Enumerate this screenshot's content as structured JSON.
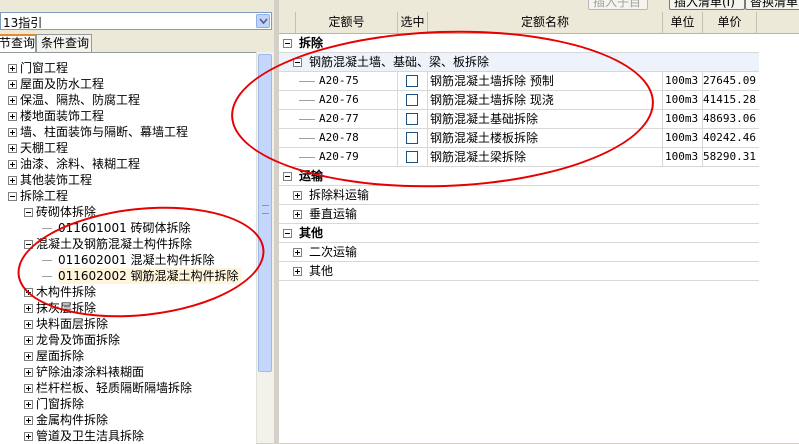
{
  "left": {
    "combo_value": "13指引",
    "tabs": [
      "章节查询",
      "条件查询"
    ],
    "tree": [
      {
        "label": "门窗工程",
        "level": 0,
        "state": "collapsed"
      },
      {
        "label": "屋面及防水工程",
        "level": 0,
        "state": "collapsed"
      },
      {
        "label": "保温、隔热、防腐工程",
        "level": 0,
        "state": "collapsed"
      },
      {
        "label": "楼地面装饰工程",
        "level": 0,
        "state": "collapsed"
      },
      {
        "label": "墙、柱面装饰与隔断、幕墙工程",
        "level": 0,
        "state": "collapsed"
      },
      {
        "label": "天棚工程",
        "level": 0,
        "state": "collapsed"
      },
      {
        "label": "油漆、涂料、裱糊工程",
        "level": 0,
        "state": "collapsed"
      },
      {
        "label": "其他装饰工程",
        "level": 0,
        "state": "collapsed"
      },
      {
        "label": "拆除工程",
        "level": 0,
        "state": "expanded"
      },
      {
        "label": "砖砌体拆除",
        "level": 1,
        "state": "expanded"
      },
      {
        "label": "011601001   砖砌体拆除",
        "level": 2,
        "state": "leaf"
      },
      {
        "label": "混凝土及钢筋混凝土构件拆除",
        "level": 1,
        "state": "expanded"
      },
      {
        "label": "011602001   混凝土构件拆除",
        "level": 2,
        "state": "leaf"
      },
      {
        "label": "011602002   钢筋混凝土构件拆除",
        "level": 2,
        "state": "leaf",
        "selected": true
      },
      {
        "label": "木构件拆除",
        "level": 1,
        "state": "collapsed"
      },
      {
        "label": "抹灰层拆除",
        "level": 1,
        "state": "collapsed"
      },
      {
        "label": "块料面层拆除",
        "level": 1,
        "state": "collapsed"
      },
      {
        "label": "龙骨及饰面拆除",
        "level": 1,
        "state": "collapsed"
      },
      {
        "label": "屋面拆除",
        "level": 1,
        "state": "collapsed"
      },
      {
        "label": "铲除油漆涂料裱糊面",
        "level": 1,
        "state": "collapsed"
      },
      {
        "label": "栏杆栏板、轻质隔断隔墙拆除",
        "level": 1,
        "state": "collapsed"
      },
      {
        "label": "门窗拆除",
        "level": 1,
        "state": "collapsed"
      },
      {
        "label": "金属构件拆除",
        "level": 1,
        "state": "collapsed"
      },
      {
        "label": "管道及卫生洁具拆除",
        "level": 1,
        "state": "collapsed"
      }
    ]
  },
  "toolbar": {
    "insert_sub_label": "插入子目",
    "insert_list_label": "插入清单(I)",
    "replace_list_label": "替换清单"
  },
  "grid": {
    "columns": [
      "定额号",
      "选中",
      "定额名称",
      "单位",
      "单价"
    ],
    "sections": [
      {
        "title": "拆除",
        "subgroups": [
          {
            "title": "钢筋混凝土墙、基础、梁、板拆除",
            "rows": [
              {
                "code": "A20-75",
                "name": "钢筋混凝土墙拆除 预制",
                "unit": "100m3",
                "price": "27645.09"
              },
              {
                "code": "A20-76",
                "name": "钢筋混凝土墙拆除 现浇",
                "unit": "100m3",
                "price": "41415.28"
              },
              {
                "code": "A20-77",
                "name": "钢筋混凝土基础拆除",
                "unit": "100m3",
                "price": "48693.06"
              },
              {
                "code": "A20-78",
                "name": "钢筋混凝土楼板拆除",
                "unit": "100m3",
                "price": "40242.46"
              },
              {
                "code": "A20-79",
                "name": "钢筋混凝土梁拆除",
                "unit": "100m3",
                "price": "58290.31"
              }
            ]
          }
        ]
      },
      {
        "title": "运输",
        "children": [
          "拆除料运输",
          "垂直运输"
        ]
      },
      {
        "title": "其他",
        "children": [
          "二次运输",
          "其他"
        ]
      }
    ]
  },
  "annotation_color": "#e60000"
}
